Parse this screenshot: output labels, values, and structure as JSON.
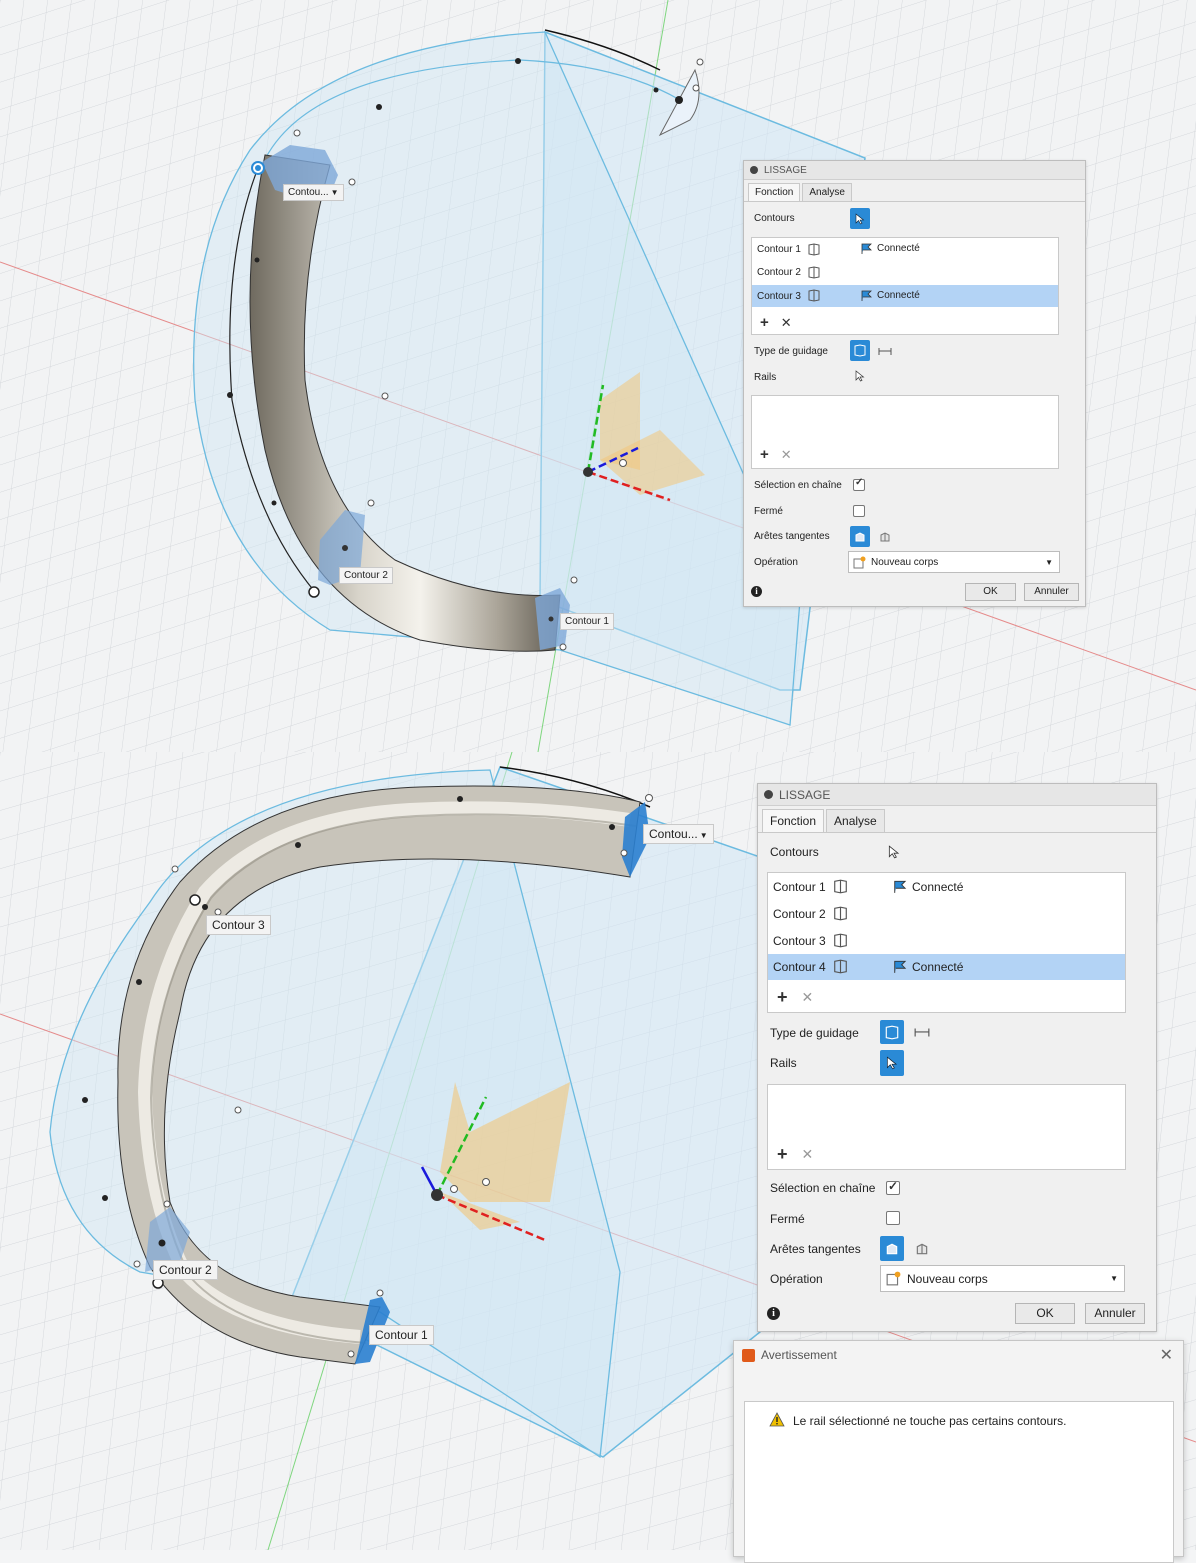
{
  "view_labels_top": {
    "contour_trunc": "Contou...",
    "contour_2": "Contour 2",
    "contour_1": "Contour 1"
  },
  "view_labels_bottom": {
    "contour_trunc": "Contou...",
    "contour_3": "Contour 3",
    "contour_2": "Contour 2",
    "contour_1": "Contour 1"
  },
  "panel_top": {
    "title": "LISSAGE",
    "tabs": [
      "Fonction",
      "Analyse"
    ],
    "contours_label": "Contours",
    "profiles": [
      {
        "name": "Contour 1",
        "status": "Connecté",
        "selected": false
      },
      {
        "name": "Contour 2",
        "status": "",
        "selected": false
      },
      {
        "name": "Contour 3",
        "status": "Connecté",
        "selected": true
      }
    ],
    "guide_type_label": "Type de guidage",
    "rails_label": "Rails",
    "chain_selection_label": "Sélection en chaîne",
    "chain_selection": true,
    "closed_label": "Fermé",
    "closed": false,
    "tangent_edges_label": "Arêtes tangentes",
    "operation_label": "Opération",
    "operation_value": "Nouveau corps",
    "ok": "OK",
    "cancel": "Annuler"
  },
  "panel_bottom": {
    "title": "LISSAGE",
    "tabs": [
      "Fonction",
      "Analyse"
    ],
    "contours_label": "Contours",
    "profiles": [
      {
        "name": "Contour 1",
        "status": "Connecté",
        "selected": false
      },
      {
        "name": "Contour 2",
        "status": "",
        "selected": false
      },
      {
        "name": "Contour 3",
        "status": "",
        "selected": false
      },
      {
        "name": "Contour 4",
        "status": "Connecté",
        "selected": true
      }
    ],
    "guide_type_label": "Type de guidage",
    "rails_label": "Rails",
    "chain_selection_label": "Sélection en chaîne",
    "chain_selection": true,
    "closed_label": "Fermé",
    "closed": false,
    "tangent_edges_label": "Arêtes tangentes",
    "operation_label": "Opération",
    "operation_value": "Nouveau corps",
    "ok": "OK",
    "cancel": "Annuler"
  },
  "warning_dialog": {
    "title": "Avertissement",
    "message": "Le rail sélectionné ne touche pas certains contours."
  },
  "colors": {
    "accent": "#2a8ad6",
    "selection": "#b3d3f5",
    "plane": "#cfe6f5",
    "plane_edge": "#6cbbe0",
    "tube": "#b9b4a8",
    "axis_x": "#e02020",
    "axis_y": "#22bb22",
    "axis_z": "#1a1adb",
    "warning_icon": "#f0c000"
  }
}
